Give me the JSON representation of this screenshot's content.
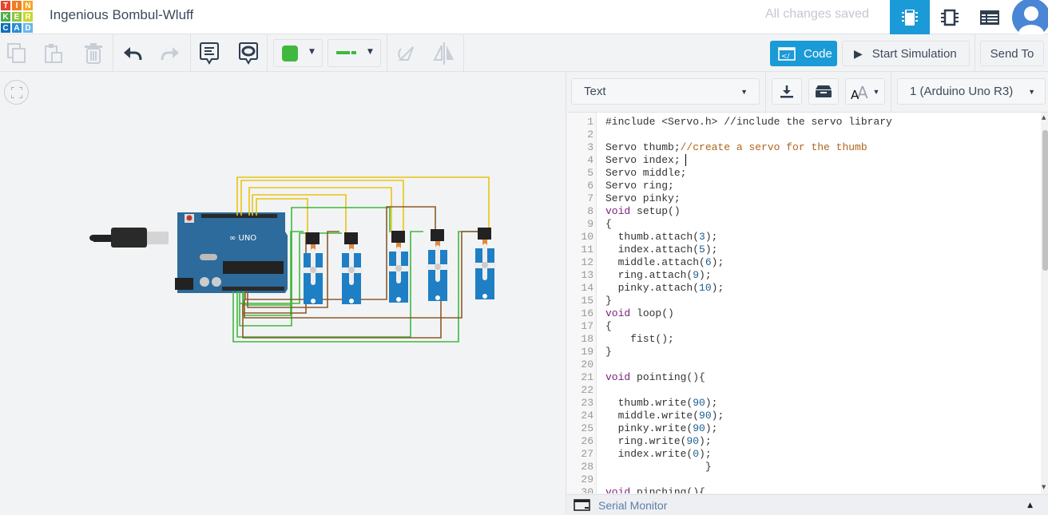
{
  "app": {
    "logo_letters": [
      "T",
      "I",
      "N",
      "K",
      "E",
      "R",
      "C",
      "A",
      "D"
    ],
    "logo_colors": [
      "#e8452c",
      "#f17d21",
      "#f6a623",
      "#4cae4c",
      "#8cc63f",
      "#c9d72a",
      "#0d6eb8",
      "#2b8fd4",
      "#6bb7e6"
    ],
    "title": "Ingenious Bombul-Wluff",
    "save_status": "All changes saved"
  },
  "topbar": {
    "views": [
      {
        "icon": "circuit-view-icon",
        "active": true
      },
      {
        "icon": "schematic-view-icon",
        "active": false
      },
      {
        "icon": "component-list-icon",
        "active": false
      }
    ],
    "accent": "#1a9ad6"
  },
  "toolbar": {
    "fill_color": "#3fb83f",
    "code_label": "Code",
    "start_simulation_label": "Start Simulation",
    "send_to_label": "Send To"
  },
  "code_panel": {
    "mode": "Text",
    "device": "1 (Arduino Uno R3)",
    "serial_monitor_label": "Serial Monitor",
    "lines": [
      [
        [
          "#include <Servo.h> //include the servo library",
          "p"
        ]
      ],
      [],
      [
        [
          "Servo thumb;",
          "p"
        ],
        [
          "//create a servo for the thumb",
          "cm"
        ]
      ],
      [
        [
          "Servo index;",
          "p"
        ]
      ],
      [
        [
          "Servo middle;",
          "p"
        ]
      ],
      [
        [
          "Servo ring;",
          "p"
        ]
      ],
      [
        [
          "Servo pinky;",
          "p"
        ]
      ],
      [
        [
          "void",
          "kw"
        ],
        [
          " setup()",
          "p"
        ]
      ],
      [
        [
          "{",
          "p"
        ]
      ],
      [
        [
          "  thumb.attach(",
          "p"
        ],
        [
          "3",
          "num"
        ],
        [
          ");",
          "p"
        ]
      ],
      [
        [
          "  index.attach(",
          "p"
        ],
        [
          "5",
          "num"
        ],
        [
          ");",
          "p"
        ]
      ],
      [
        [
          "  middle.attach(",
          "p"
        ],
        [
          "6",
          "num"
        ],
        [
          ");",
          "p"
        ]
      ],
      [
        [
          "  ring.attach(",
          "p"
        ],
        [
          "9",
          "num"
        ],
        [
          ");",
          "p"
        ]
      ],
      [
        [
          "  pinky.attach(",
          "p"
        ],
        [
          "10",
          "num"
        ],
        [
          ");",
          "p"
        ]
      ],
      [
        [
          "}",
          "p"
        ]
      ],
      [
        [
          "void",
          "kw"
        ],
        [
          " loop()",
          "p"
        ]
      ],
      [
        [
          "{",
          "p"
        ]
      ],
      [
        [
          "    fist();",
          "p"
        ]
      ],
      [
        [
          "}",
          "p"
        ]
      ],
      [],
      [
        [
          "void",
          "kw"
        ],
        [
          " pointing(){",
          "p"
        ]
      ],
      [],
      [
        [
          "  thumb.write(",
          "p"
        ],
        [
          "90",
          "num"
        ],
        [
          ");",
          "p"
        ]
      ],
      [
        [
          "  middle.write(",
          "p"
        ],
        [
          "90",
          "num"
        ],
        [
          ");",
          "p"
        ]
      ],
      [
        [
          "  pinky.write(",
          "p"
        ],
        [
          "90",
          "num"
        ],
        [
          ");",
          "p"
        ]
      ],
      [
        [
          "  ring.write(",
          "p"
        ],
        [
          "90",
          "num"
        ],
        [
          ");",
          "p"
        ]
      ],
      [
        [
          "  index.write(",
          "p"
        ],
        [
          "0",
          "num"
        ],
        [
          ");",
          "p"
        ]
      ],
      [
        [
          "                }",
          "p"
        ]
      ],
      [],
      [
        [
          "void",
          "kw"
        ],
        [
          " pinching(){",
          "p"
        ]
      ]
    ]
  }
}
